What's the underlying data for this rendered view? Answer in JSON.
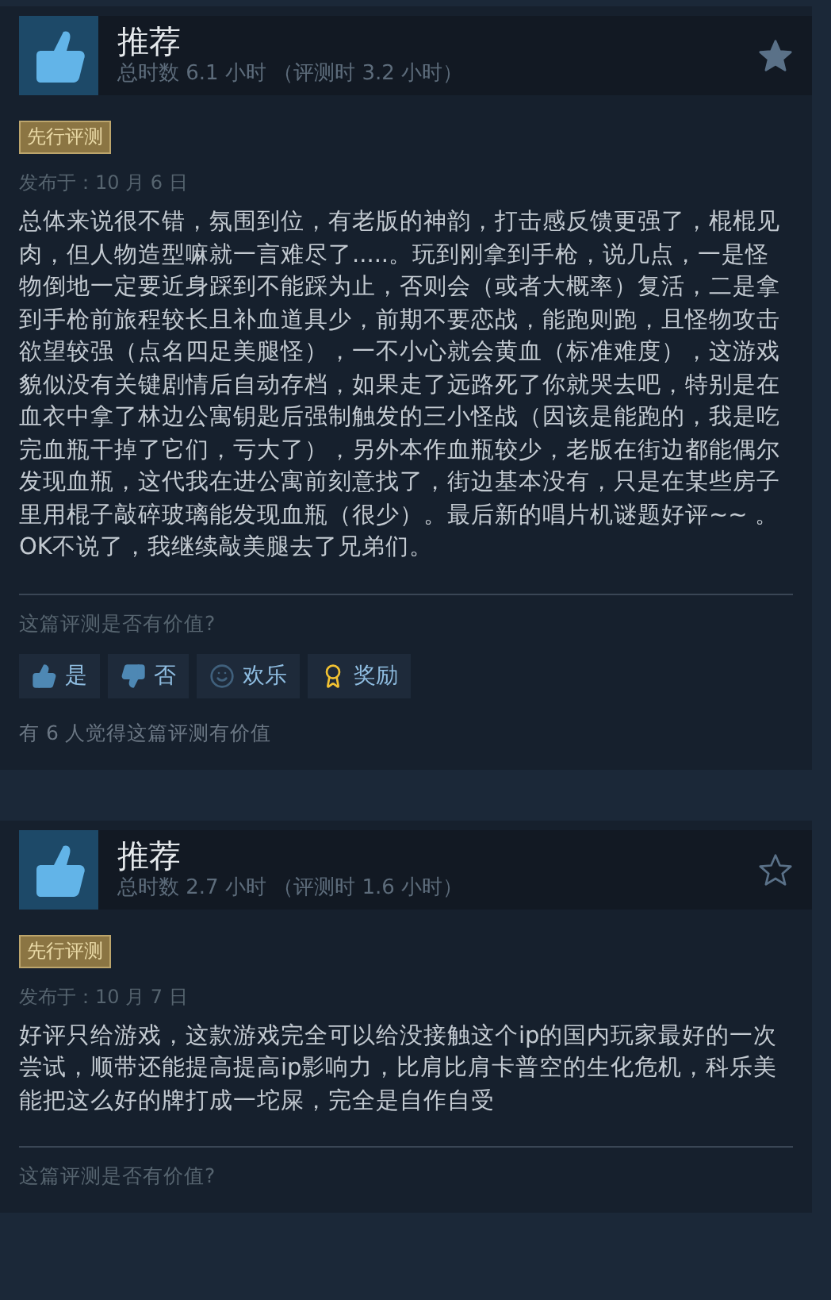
{
  "reviews": [
    {
      "recommendation": "推荐",
      "hours": "总时数 6.1 小时 （评测时 3.2 小时）",
      "starred": true,
      "badge": "先行评测",
      "date": "发布于：10 月 6 日",
      "body": "总体来说很不错，氛围到位，有老版的神韵，打击感反馈更强了，棍棍见肉，但人物造型嘛就一言难尽了.....。玩到刚拿到手枪，说几点，一是怪物倒地一定要近身踩到不能踩为止，否则会（或者大概率）复活，二是拿到手枪前旅程较长且补血道具少，前期不要恋战，能跑则跑，且怪物攻击欲望较强（点名四足美腿怪），一不小心就会黄血（标准难度），这游戏貌似没有关键剧情后自动存档，如果走了远路死了你就哭去吧，特别是在血衣中拿了林边公寓钥匙后强制触发的三小怪战（因该是能跑的，我是吃完血瓶干掉了它们，亏大了），另外本作血瓶较少，老版在街边都能偶尔发现血瓶，这代我在进公寓前刻意找了，街边基本没有，只是在某些房子里用棍子敲碎玻璃能发现血瓶（很少）。最后新的唱片机谜题好评~~ 。OK不说了，我继续敲美腿去了兄弟们。",
      "question": "这篇评测是否有价值?",
      "vote_buttons": [
        {
          "kind": "up",
          "label": "是"
        },
        {
          "kind": "down",
          "label": "否"
        },
        {
          "kind": "funny",
          "label": "欢乐"
        },
        {
          "kind": "award",
          "label": "奖励"
        }
      ],
      "helpful_count": "有 6 人觉得这篇评测有价值"
    },
    {
      "recommendation": "推荐",
      "hours": "总时数 2.7 小时 （评测时 1.6 小时）",
      "starred": false,
      "badge": "先行评测",
      "date": "发布于：10 月 7 日",
      "body": "好评只给游戏，这款游戏完全可以给没接触这个ip的国内玩家最好的一次尝试，顺带还能提高提高ip影响力，比肩比肩卡普空的生化危机，科乐美能把这么好的牌打成一坨屎，完全是自作自受",
      "question": "这篇评测是否有价值?"
    }
  ]
}
